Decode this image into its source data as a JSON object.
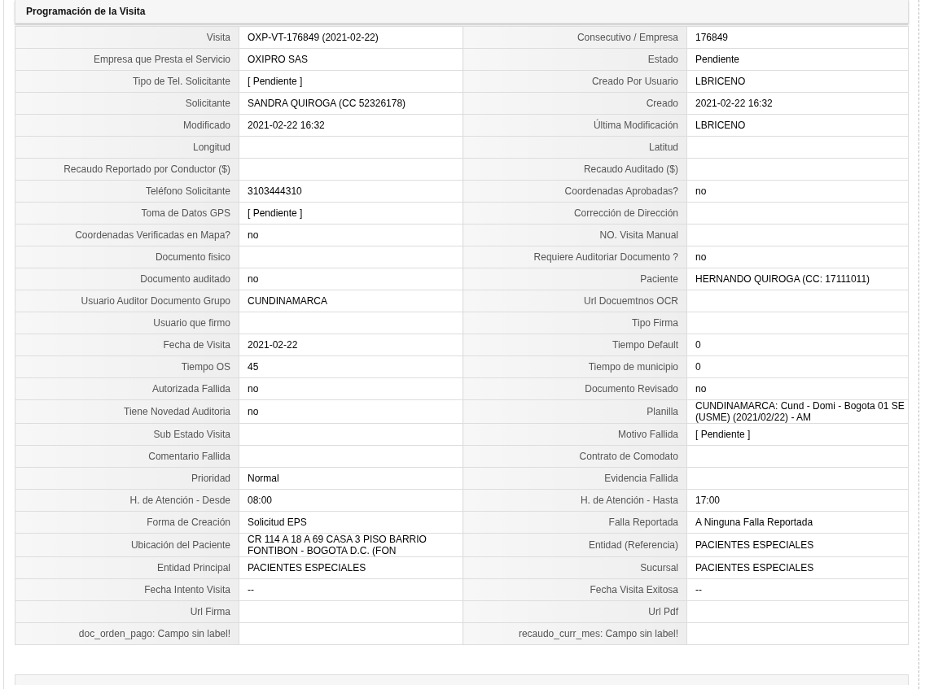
{
  "panel": {
    "title": "Programación de la Visita"
  },
  "rows": [
    {
      "left": {
        "label": "Visita",
        "value": "OXP-VT-176849 (2021-02-22)"
      },
      "right": {
        "label": "Consecutivo / Empresa",
        "value": "176849"
      }
    },
    {
      "left": {
        "label": "Empresa que Presta el Servicio",
        "value": "OXIPRO SAS"
      },
      "right": {
        "label": "Estado",
        "value": "Pendiente"
      }
    },
    {
      "left": {
        "label": "Tipo de Tel. Solicitante",
        "value": "[ Pendiente ]"
      },
      "right": {
        "label": "Creado Por Usuario",
        "value": "LBRICENO"
      }
    },
    {
      "left": {
        "label": "Solicitante",
        "value": "SANDRA QUIROGA (CC 52326178)"
      },
      "right": {
        "label": "Creado",
        "value": "2021-02-22 16:32"
      }
    },
    {
      "left": {
        "label": "Modificado",
        "value": "2021-02-22 16:32"
      },
      "right": {
        "label": "Última Modificación",
        "value": "LBRICENO"
      }
    },
    {
      "left": {
        "label": "Longitud"
      },
      "right": {
        "label": "Latitud"
      }
    },
    {
      "left": {
        "label": "Recaudo Reportado por Conductor ($)"
      },
      "right": {
        "label": "Recaudo Auditado ($)"
      }
    },
    {
      "left": {
        "label": "Teléfono Solicitante",
        "value": "3103444310"
      },
      "right": {
        "label": "Coordenadas Aprobadas?",
        "value": "no"
      }
    },
    {
      "left": {
        "label": "Toma de Datos GPS",
        "value": "[ Pendiente ]"
      },
      "right": {
        "label": "Corrección de Dirección"
      }
    },
    {
      "left": {
        "label": "Coordenadas Verificadas en Mapa?",
        "value": "no"
      },
      "right": {
        "label": "NO. Visita Manual"
      }
    },
    {
      "left": {
        "label": "Documento fisico"
      },
      "right": {
        "label": "Requiere Auditoriar Documento ?",
        "value": "no"
      }
    },
    {
      "left": {
        "label": "Documento auditado",
        "value": "no"
      },
      "right": {
        "label": "Paciente",
        "value": "HERNANDO QUIROGA (CC: 17111011)"
      }
    },
    {
      "left": {
        "label": "Usuario Auditor Documento Grupo",
        "value": "CUNDINAMARCA"
      },
      "right": {
        "label": "Url Docuemtnos OCR"
      }
    },
    {
      "left": {
        "label": "Usuario que firmo"
      },
      "right": {
        "label": "Tipo Firma"
      }
    },
    {
      "left": {
        "label": "Fecha de Visita",
        "value": "2021-02-22"
      },
      "right": {
        "label": "Tiempo Default",
        "value": "0"
      }
    },
    {
      "left": {
        "label": "Tiempo OS",
        "value": "45"
      },
      "right": {
        "label": "Tiempo de municipio",
        "value": "0"
      }
    },
    {
      "left": {
        "label": "Autorizada Fallida",
        "value": "no"
      },
      "right": {
        "label": "Documento Revisado",
        "value": "no"
      }
    },
    {
      "left": {
        "label": "Tiene Novedad Auditoria",
        "value": "no"
      },
      "right": {
        "label": "Planilla",
        "value": "CUNDINAMARCA: Cund - Domi - Bogota 01 SE (USME) (2021/02/22) - AM"
      }
    },
    {
      "left": {
        "label": "Sub Estado Visita"
      },
      "right": {
        "label": "Motivo Fallida",
        "value": "[ Pendiente ]"
      }
    },
    {
      "left": {
        "label": "Comentario Fallida"
      },
      "right": {
        "label": "Contrato de Comodato"
      }
    },
    {
      "left": {
        "label": "Prioridad",
        "value": "Normal"
      },
      "right": {
        "label": "Evidencia Fallida"
      }
    },
    {
      "left": {
        "label": "H. de Atención - Desde",
        "value": "08:00"
      },
      "right": {
        "label": "H. de Atención - Hasta",
        "value": "17:00"
      }
    },
    {
      "left": {
        "label": "Forma de Creación",
        "value": "Solicitud EPS"
      },
      "right": {
        "label": "Falla Reportada",
        "value": "A Ninguna Falla Reportada"
      }
    },
    {
      "left": {
        "label": "Ubicación del Paciente",
        "value": "CR 114 A 18 A 69 CASA 3 PISO BARRIO FONTIBON - BOGOTA D.C. (FON"
      },
      "right": {
        "label": "Entidad (Referencia)",
        "value": "PACIENTES ESPECIALES"
      }
    },
    {
      "left": {
        "label": "Entidad Principal",
        "value": "PACIENTES ESPECIALES"
      },
      "right": {
        "label": "Sucursal",
        "value": "PACIENTES ESPECIALES"
      }
    },
    {
      "left": {
        "label": "Fecha Intento Visita",
        "value": "--"
      },
      "right": {
        "label": "Fecha Visita Exitosa",
        "value": "--"
      }
    },
    {
      "left": {
        "label": "Url Firma"
      },
      "right": {
        "label": "Url Pdf"
      }
    },
    {
      "left": {
        "label": "doc_orden_pago: Campo sin label!"
      },
      "right": {
        "label": "recaudo_curr_mes: Campo sin label!"
      }
    }
  ]
}
